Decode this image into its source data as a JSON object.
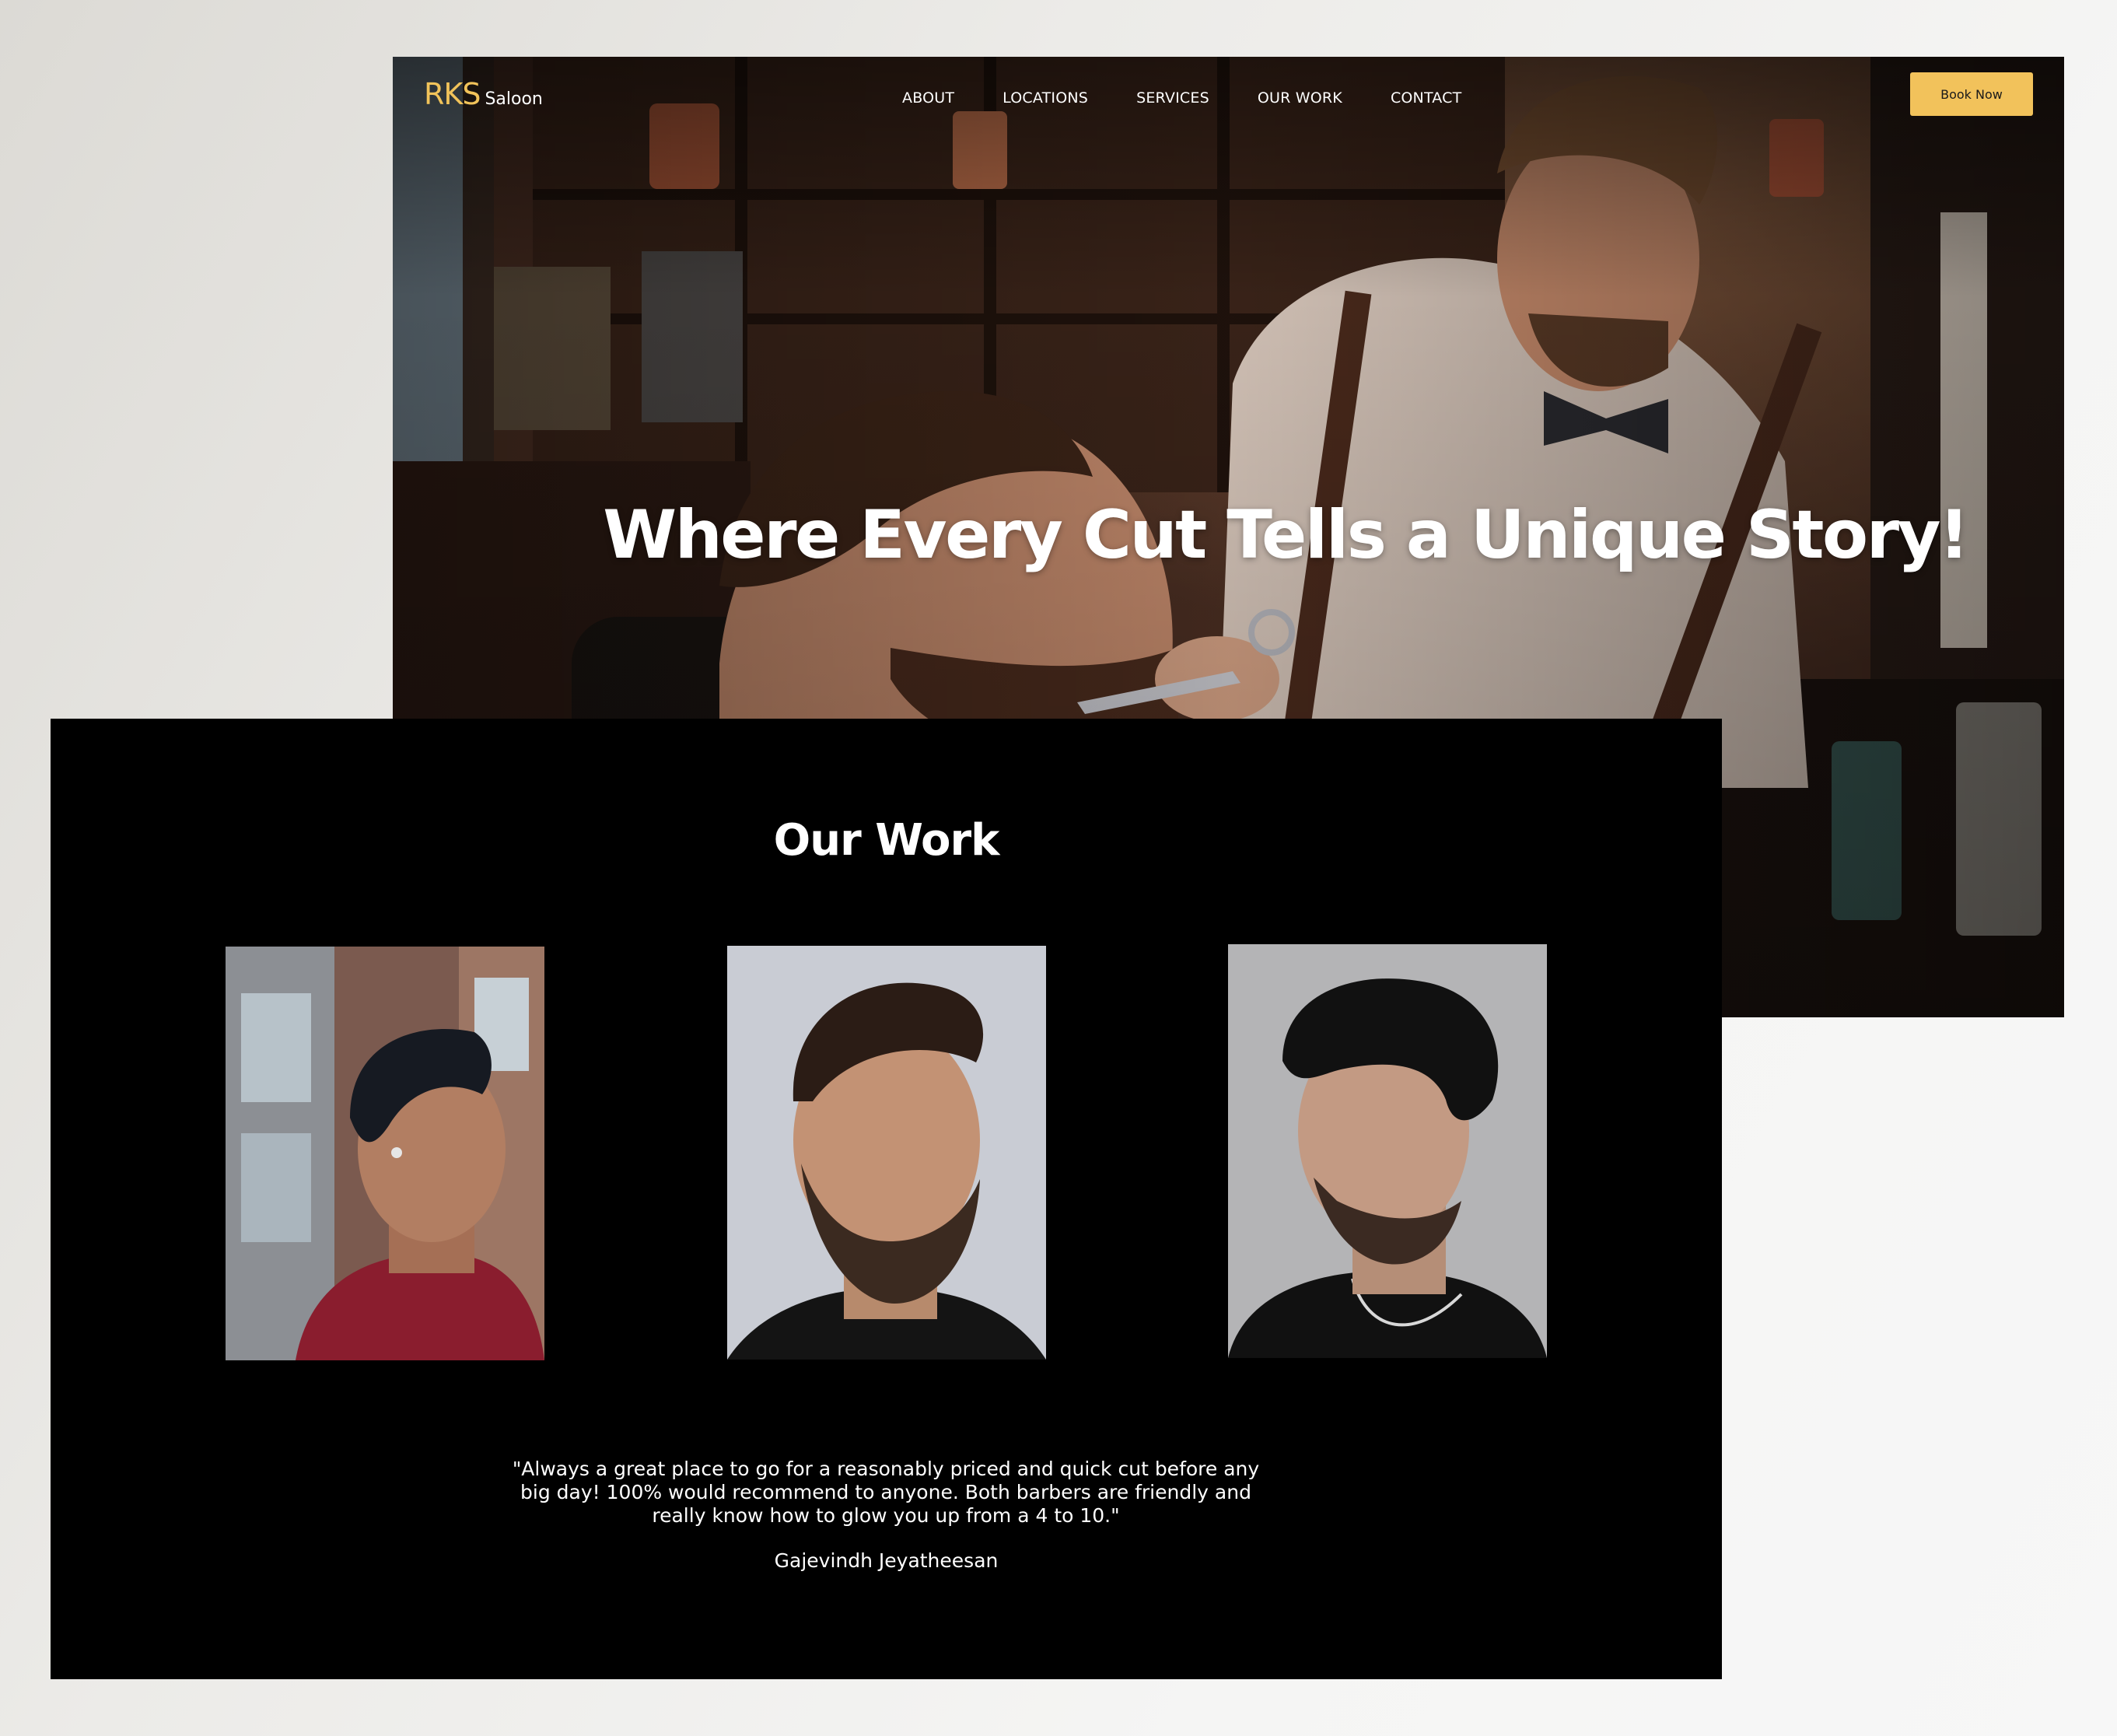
{
  "brand": {
    "mark": "RKS",
    "name": "Saloon",
    "accent_color": "#f2c25b"
  },
  "nav": {
    "links": [
      "ABOUT",
      "LOCATIONS",
      "SERVICES",
      "OUR WORK",
      "CONTACT"
    ],
    "cta_label": "Book Now"
  },
  "hero": {
    "headline": "Where Every Cut Tells a Unique Story!",
    "image": "barber-trimming-beard-photo"
  },
  "work": {
    "title": "Our Work",
    "gallery": [
      {
        "image": "side-part-fade-haircut-photo"
      },
      {
        "image": "textured-quiff-with-beard-photo"
      },
      {
        "image": "curly-mullet-fade-photo"
      }
    ],
    "testimonial": {
      "quote": "\"Always a great place to go for a reasonably priced and quick cut before any big day! 100% would recommend to anyone. Both barbers are friendly and really know how to glow you up from a 4 to 10.\"",
      "author": "Gajevindh Jeyatheesan"
    }
  }
}
